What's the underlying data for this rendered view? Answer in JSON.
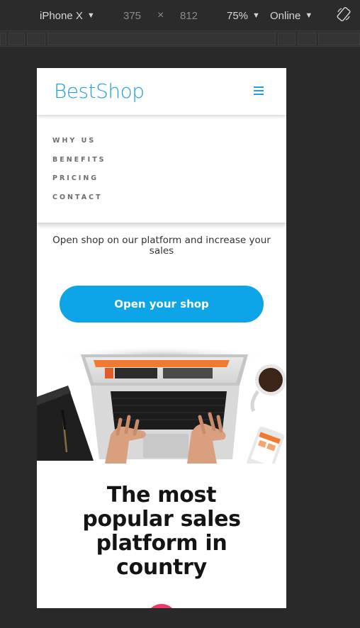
{
  "devtools": {
    "device": "iPhone X",
    "width": "375",
    "times": "×",
    "height": "812",
    "zoom": "75%",
    "network": "Online",
    "caret": "▼"
  },
  "site": {
    "logo": "BestShop",
    "nav": [
      "WHY US",
      "BENEFITS",
      "PRICING",
      "CONTACT"
    ],
    "tagline": "Open shop on our platform and increase your sales",
    "cta_label": "Open your shop",
    "headline": "The most popular sales platform in country"
  },
  "colors": {
    "brand_blue": "#1d9fe0",
    "cta_blue": "#0ea4e8",
    "accent_pink": "#ea3b6a",
    "devtools_bg": "#292929"
  },
  "icons": {
    "menu": "hamburger-icon",
    "rotate": "rotate-icon"
  }
}
